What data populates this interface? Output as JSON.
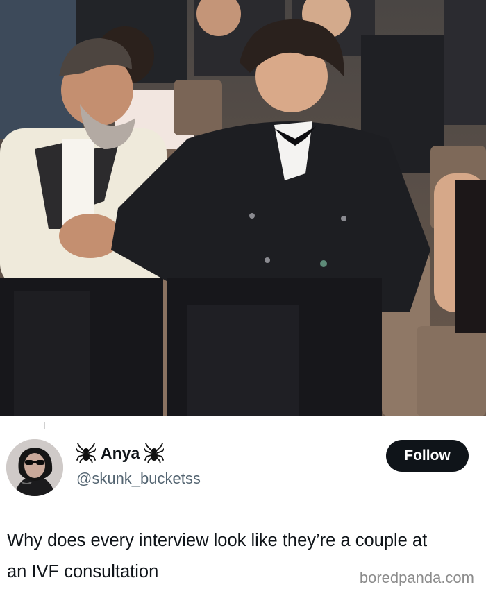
{
  "tweet": {
    "display_name": "Anya",
    "name_emoji": "spider-icon",
    "handle": "@skunk_bucketss",
    "follow_label": "Follow",
    "text": "Why does every interview look like they’re a couple at an IVF consultation"
  },
  "watermark": "boredpanda.com",
  "colors": {
    "follow_bg": "#0f1419",
    "text": "#0f1419",
    "handle": "#536471",
    "watermark": "#8c8c8c"
  }
}
